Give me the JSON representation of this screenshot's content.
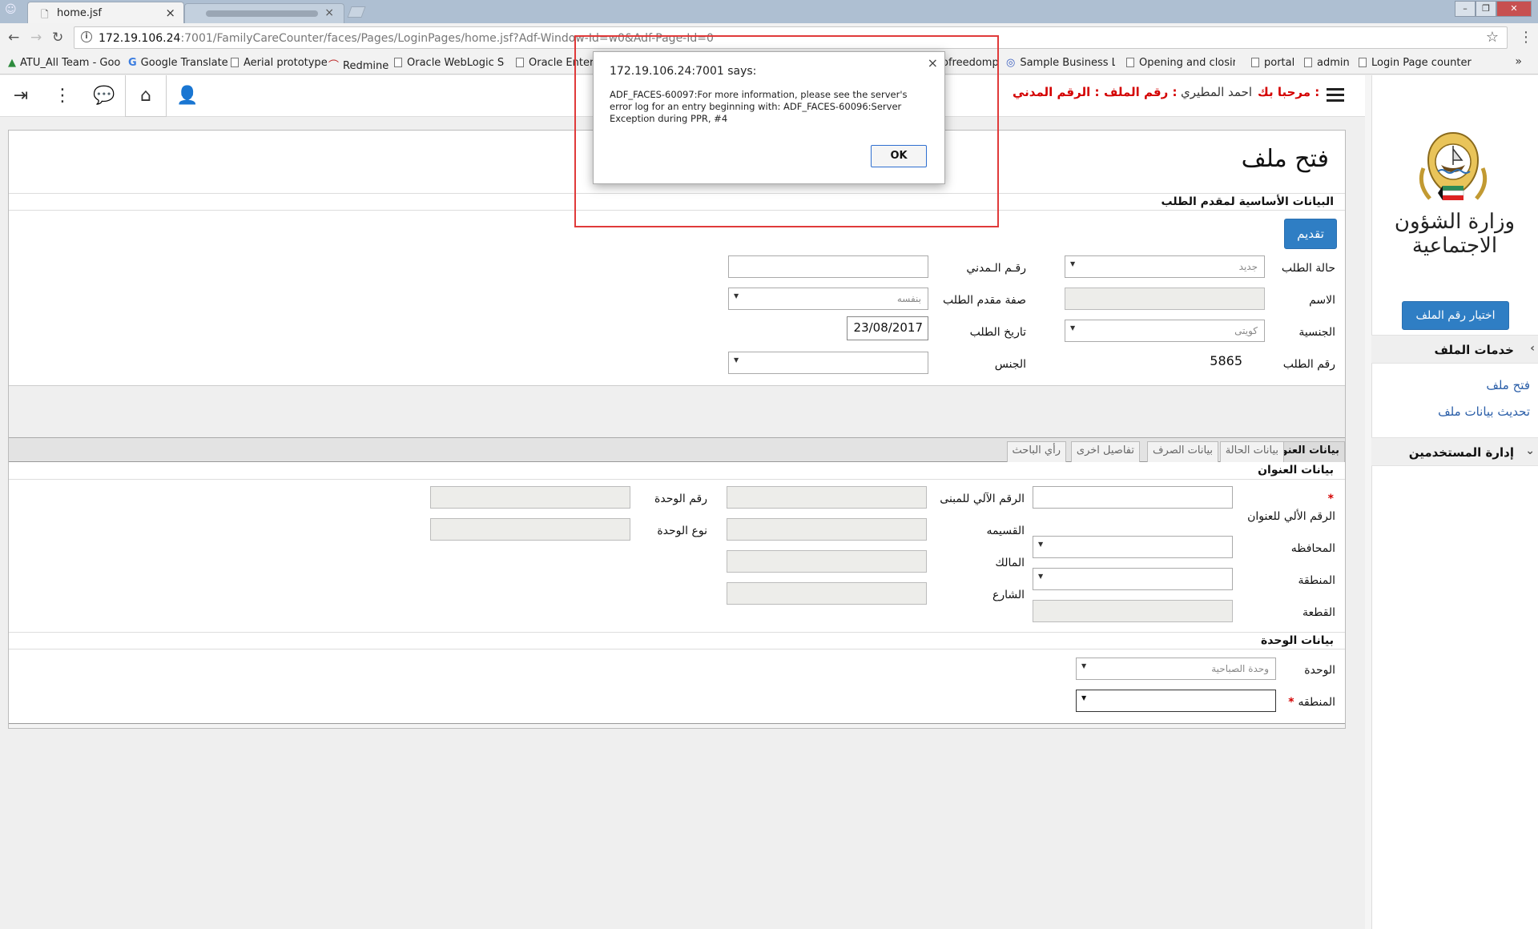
{
  "browser": {
    "tab_title": "home.jsf",
    "url_host": "172.19.106.24",
    "url_rest": ":7001/FamilyCareCounter/faces/Pages/LoginPages/home.jsf?Adf-Window-Id=w0&Adf-Page-Id=0",
    "bookmarks": [
      "ATU_All Team - Goog",
      "Google Translate",
      "Aerial prototype",
      "Redmine",
      "Oracle WebLogic Ser",
      "Oracle Enterpr",
      "ofreedomp",
      "Sample Business Lett",
      "Opening and closing",
      "portal",
      "admin",
      "Login Page counter"
    ]
  },
  "header": {
    "welcome_label": "مرحبا بك :",
    "user_name": "احمد المطيري",
    "file_no_label": "رقم الملف :",
    "civil_no_label": "الرقم المدني :"
  },
  "sidebar": {
    "ministry_name": "وزارة الشؤون الاجتماعية",
    "choose_file_button": "اختيار رقم الملف",
    "file_services_title": "خدمات الملف",
    "links": [
      "فتح ملف",
      "تحديث بيانات ملف"
    ],
    "user_mgmt_title": "إدارة المستخدمين"
  },
  "main": {
    "page_title": "فتح ملف",
    "section_basic": "البيانات الأساسية لمقدم الطلب",
    "submit_button": "تقديم",
    "fields": {
      "request_status_label": "حالة الطلب",
      "request_status_value": "جديد",
      "name_label": "الاسم",
      "nationality_label": "الجنسية",
      "nationality_value": "كويتى",
      "request_no_label": "رقم الطلب",
      "request_no_value": "5865",
      "civil_no_label": "رقـم الـمدني",
      "applicant_role_label": "صفة مقدم الطلب",
      "applicant_role_value": "بنفسه",
      "request_date_label": "تاريخ الطلب",
      "request_date_value": "23/08/2017",
      "gender_label": "الجنس"
    },
    "tabs": [
      "بيانات العنوان",
      "بيانات الحالة",
      "بيانات الصرف",
      "تفاصيل اخرى",
      "رأي الباحث"
    ],
    "address": {
      "section_title": "بيانات العنوان",
      "auto_address_label": "الرقم الألي للعنوان",
      "governorate_label": "المحافظه",
      "area_label": "المنطقة",
      "block_label": "القطعة",
      "auto_building_label": "الرقم الآلي للمبنى",
      "voucher_label": "القسيمه",
      "owner_label": "المالك",
      "street_label": "الشارع",
      "unit_no_label": "رقم الوحدة",
      "unit_type_label": "نوع الوحدة"
    },
    "unit": {
      "section_title": "بيانات الوحدة",
      "unit_label": "الوحدة",
      "unit_value": "وحدة الصباحية",
      "region_label": "المنطقه"
    }
  },
  "dialog": {
    "title": "172.19.106.24:7001 says:",
    "message": "ADF_FACES-60097:For more information, please see the server's error log for an entry beginning with: ADF_FACES-60096:Server Exception during PPR, #4",
    "ok_label": "OK"
  }
}
